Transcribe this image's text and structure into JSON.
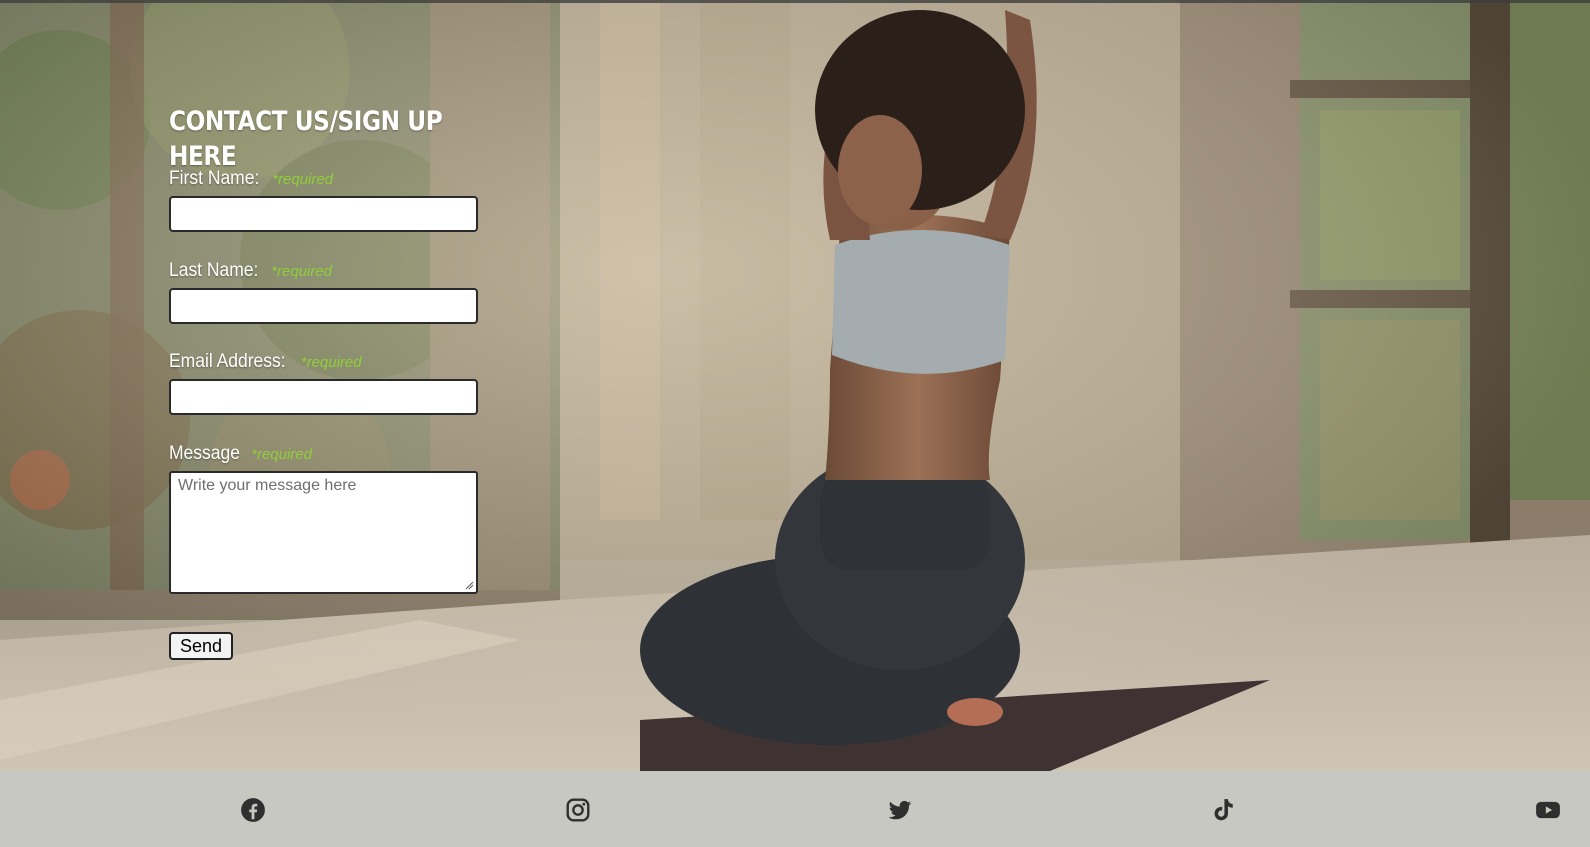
{
  "form": {
    "title": "CONTACT US/SIGN UP HERE",
    "required_label": "*required",
    "fields": {
      "first_name": {
        "label": "First Name:",
        "value": ""
      },
      "last_name": {
        "label": "Last Name:",
        "value": ""
      },
      "email": {
        "label": "Email Address:",
        "value": ""
      },
      "message": {
        "label": "Message",
        "placeholder": "Write your message here",
        "value": ""
      }
    },
    "submit_label": "Send"
  },
  "footer": {
    "social": [
      {
        "icon": "facebook-icon"
      },
      {
        "icon": "instagram-icon"
      },
      {
        "icon": "twitter-icon"
      },
      {
        "icon": "tiktok-icon"
      },
      {
        "icon": "youtube-icon"
      }
    ]
  },
  "colors": {
    "required_accent": "#8fce3a",
    "footer_bg": "#c8c8c3",
    "icon_color": "#2f2f2f"
  }
}
